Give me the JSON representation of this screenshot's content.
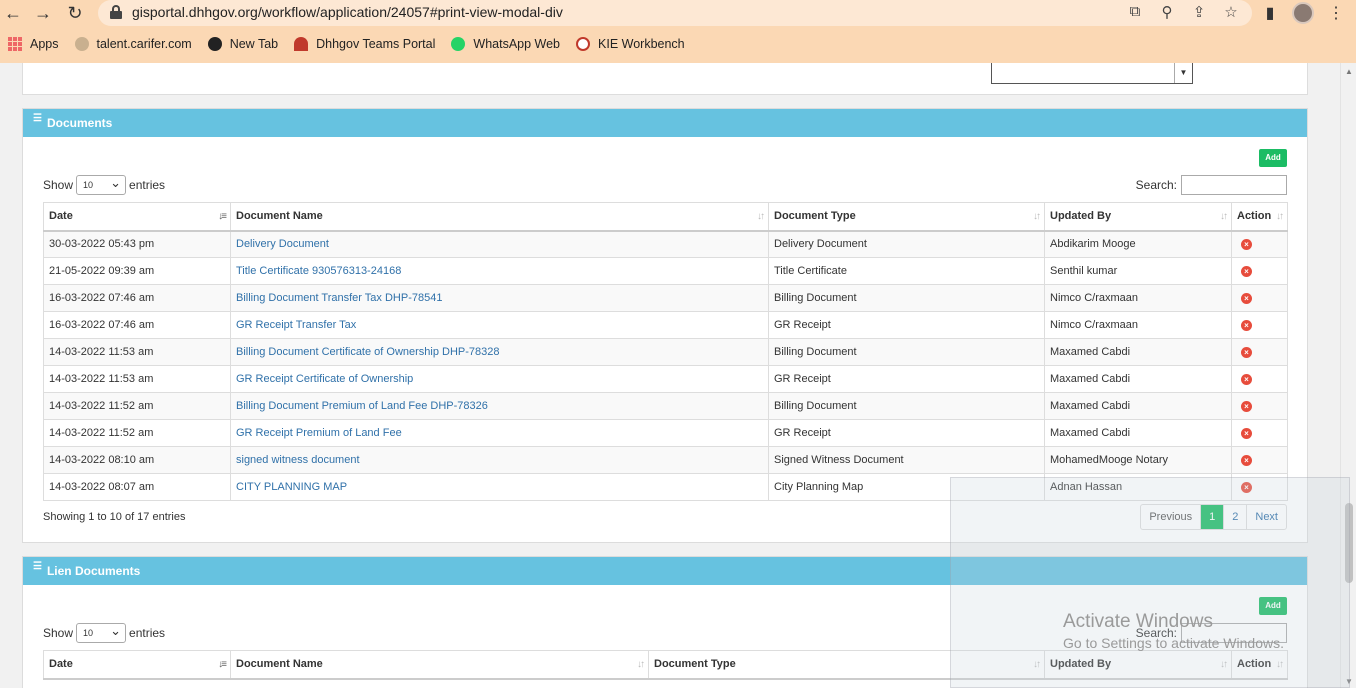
{
  "browser": {
    "url": "gisportal.dhhgov.org/workflow/application/24057#print-view-modal-div",
    "bookmarks": [
      {
        "label": "Apps"
      },
      {
        "label": "talent.carifer.com"
      },
      {
        "label": "New Tab"
      },
      {
        "label": "Dhhgov Teams Portal"
      },
      {
        "label": "WhatsApp Web"
      },
      {
        "label": "KIE Workbench"
      }
    ]
  },
  "documents": {
    "title": "Documents",
    "add_label": "Add",
    "show_label": "Show",
    "entries_label": "entries",
    "page_size": "10",
    "search_label": "Search:",
    "columns": [
      "Date",
      "Document Name",
      "Document Type",
      "Updated By",
      "Action"
    ],
    "rows": [
      {
        "date": "30-03-2022 05:43 pm",
        "name": "Delivery Document",
        "type": "Delivery Document",
        "by": "Abdikarim Mooge"
      },
      {
        "date": "21-05-2022 09:39 am",
        "name": "Title Certificate 930576313-24168",
        "type": "Title Certificate",
        "by": "Senthil kumar"
      },
      {
        "date": "16-03-2022 07:46 am",
        "name": "Billing Document Transfer Tax DHP-78541",
        "type": "Billing Document",
        "by": "Nimco C/raxmaan"
      },
      {
        "date": "16-03-2022 07:46 am",
        "name": "GR Receipt Transfer Tax",
        "type": "GR Receipt",
        "by": "Nimco C/raxmaan"
      },
      {
        "date": "14-03-2022 11:53 am",
        "name": "Billing Document Certificate of Ownership DHP-78328",
        "type": "Billing Document",
        "by": "Maxamed Cabdi"
      },
      {
        "date": "14-03-2022 11:53 am",
        "name": "GR Receipt Certificate of Ownership",
        "type": "GR Receipt",
        "by": "Maxamed Cabdi"
      },
      {
        "date": "14-03-2022 11:52 am",
        "name": "Billing Document Premium of Land Fee DHP-78326",
        "type": "Billing Document",
        "by": "Maxamed Cabdi"
      },
      {
        "date": "14-03-2022 11:52 am",
        "name": "GR Receipt Premium of Land Fee",
        "type": "GR Receipt",
        "by": "Maxamed Cabdi"
      },
      {
        "date": "14-03-2022 08:10 am",
        "name": "signed witness document",
        "type": "Signed Witness Document",
        "by": "MohamedMooge Notary"
      },
      {
        "date": "14-03-2022 08:07 am",
        "name": "CITY PLANNING MAP",
        "type": "City Planning Map",
        "by": "Adnan Hassan"
      }
    ],
    "info": "Showing 1 to 10 of 17 entries",
    "pager": {
      "previous": "Previous",
      "pages": [
        "1",
        "2"
      ],
      "next": "Next"
    }
  },
  "lien": {
    "title": "Lien Documents",
    "add_label": "Add",
    "show_label": "Show",
    "entries_label": "entries",
    "page_size": "10",
    "search_label": "Search:",
    "columns": [
      "Date",
      "Document Name",
      "Document Type",
      "Updated By",
      "Action"
    ]
  },
  "watermark": {
    "title": "Activate Windows",
    "subtitle": "Go to Settings to activate Windows."
  },
  "colors": {
    "panel_header": "#66c2e0",
    "add_button": "#1bbc64",
    "link": "#3071a9",
    "delete_icon": "#e74c3c"
  }
}
